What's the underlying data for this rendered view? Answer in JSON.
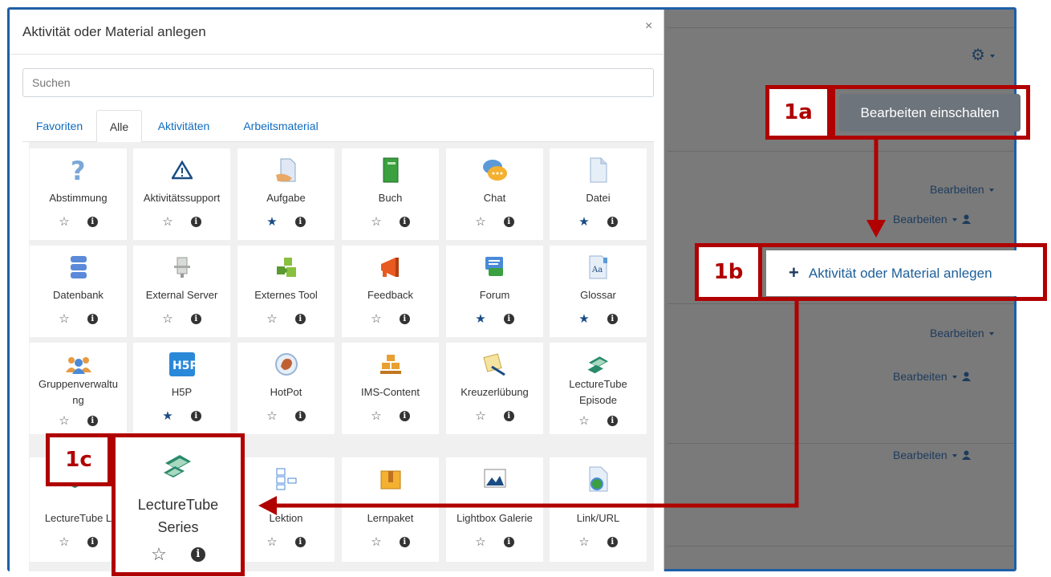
{
  "modal": {
    "title": "Aktivität oder Material anlegen",
    "close": "×",
    "search_placeholder": "Suchen",
    "tabs": [
      {
        "label": "Favoriten",
        "active": false
      },
      {
        "label": "Alle",
        "active": true
      },
      {
        "label": "Aktivitäten",
        "active": false
      },
      {
        "label": "Arbeitsmaterial",
        "active": false
      }
    ],
    "tiles": [
      {
        "label": "Abstimmung",
        "icon": "question-icon",
        "favorite": false
      },
      {
        "label": "Aktivitätssupport",
        "icon": "warning-icon",
        "favorite": false
      },
      {
        "label": "Aufgabe",
        "icon": "assignment-icon",
        "favorite": true
      },
      {
        "label": "Buch",
        "icon": "book-icon",
        "favorite": false
      },
      {
        "label": "Chat",
        "icon": "chat-icon",
        "favorite": false
      },
      {
        "label": "Datei",
        "icon": "file-icon",
        "favorite": true
      },
      {
        "label": "Datenbank",
        "icon": "database-icon",
        "favorite": false
      },
      {
        "label": "External Server",
        "icon": "server-icon",
        "favorite": false
      },
      {
        "label": "Externes Tool",
        "icon": "puzzle-icon",
        "favorite": false
      },
      {
        "label": "Feedback",
        "icon": "megaphone-icon",
        "favorite": false
      },
      {
        "label": "Forum",
        "icon": "forum-icon",
        "favorite": true
      },
      {
        "label": "Glossar",
        "icon": "glossary-icon",
        "favorite": true
      },
      {
        "label": "Gruppenverwaltu ng",
        "icon": "group-icon",
        "favorite": false
      },
      {
        "label": "H5P",
        "icon": "h5p-icon",
        "favorite": true
      },
      {
        "label": "HotPot",
        "icon": "hotpot-icon",
        "favorite": false
      },
      {
        "label": "IMS-Content",
        "icon": "ims-icon",
        "favorite": false
      },
      {
        "label": "Kreuzerlübung",
        "icon": "crossword-icon",
        "favorite": false
      },
      {
        "label": "LectureTube Episode",
        "icon": "lecturetube-icon",
        "favorite": false
      },
      {
        "label": "LectureTube L",
        "icon": "lecturetube-icon",
        "favorite": false
      },
      {
        "label": "",
        "icon": "",
        "favorite": false
      },
      {
        "label": "Lektion",
        "icon": "lesson-icon",
        "favorite": false
      },
      {
        "label": "Lernpaket",
        "icon": "package-icon",
        "favorite": false
      },
      {
        "label": "Lightbox Galerie",
        "icon": "gallery-icon",
        "favorite": false
      },
      {
        "label": "Link/URL",
        "icon": "url-icon",
        "favorite": false
      }
    ],
    "star_empty": "☆",
    "star_full": "★",
    "info": "i"
  },
  "background": {
    "edit_label": "Bearbeiten",
    "edit_toggle": "Bearbeiten einschalten",
    "add_activity": "Aktivität oder Material anlegen",
    "plus": "+"
  },
  "annotations": {
    "a": "1a",
    "b": "1b",
    "c": "1c"
  },
  "zoom_tile": {
    "label_line1": "LectureTube",
    "label_line2": "Series"
  },
  "colors": {
    "annotation": "#b00000",
    "link": "#0f6cbf",
    "favorite_star": "#1a4c84",
    "edit_button": "#6d747c"
  }
}
